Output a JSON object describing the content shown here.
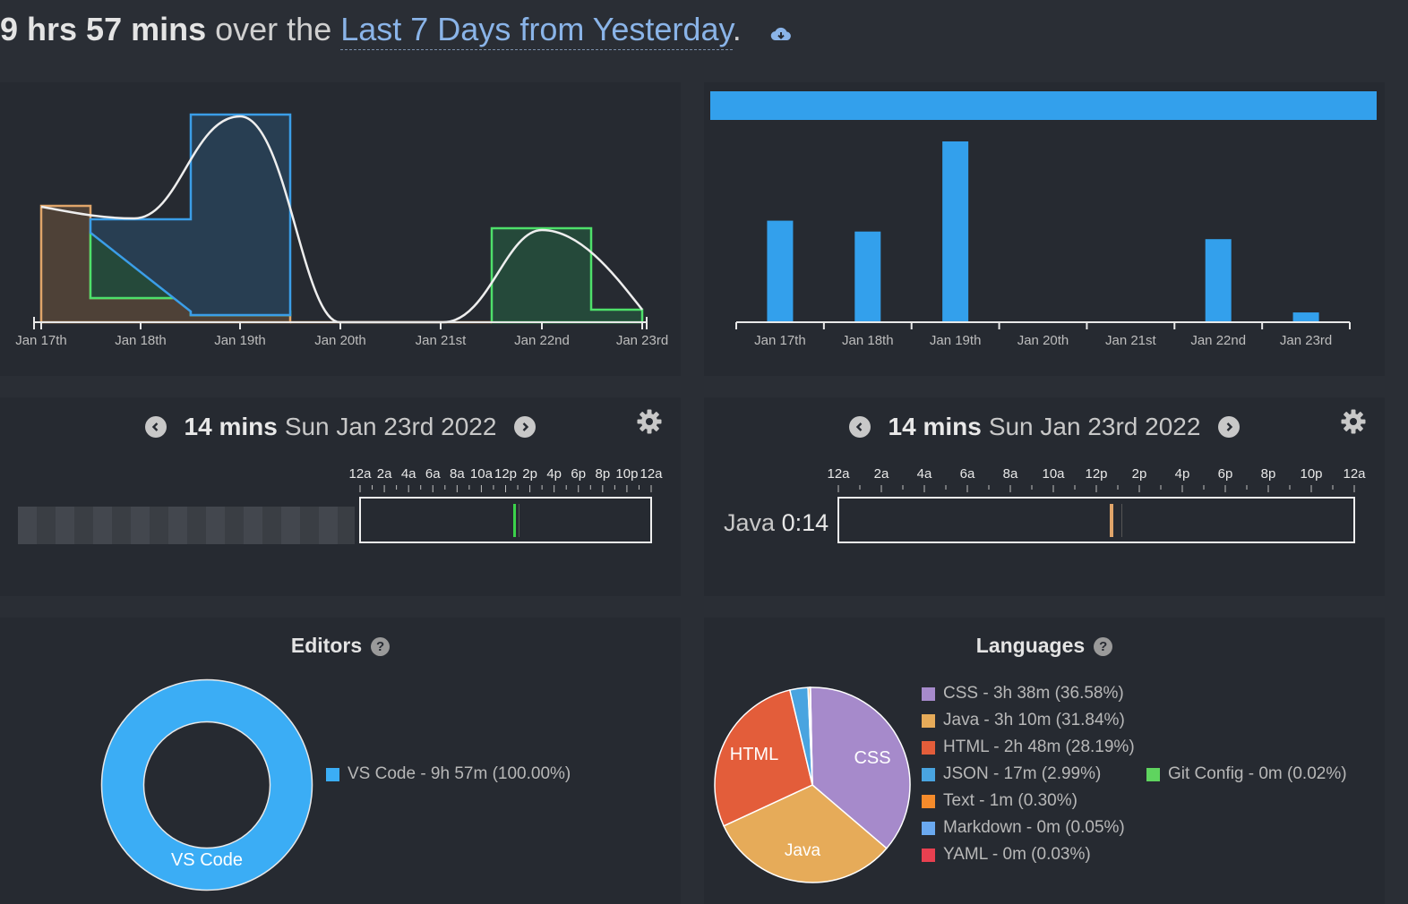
{
  "header": {
    "total": "9 hrs 57 mins",
    "middle": "over the",
    "range": "Last 7 Days from Yesterday",
    "period": ".",
    "cloud_icon": "cloud-download-icon"
  },
  "activity_chart": {
    "x_ticks": [
      "Jan 17th",
      "Jan 18th",
      "Jan 19th",
      "Jan 20th",
      "Jan 21st",
      "Jan 22nd",
      "Jan 23rd"
    ],
    "colors": {
      "orange": "#e0a56a",
      "green": "#4ee06a",
      "blue": "#3b9ee8",
      "curve": "#f0f0f0"
    }
  },
  "chart_data": {
    "type": "bar",
    "categories": [
      "Jan 17th",
      "Jan 18th",
      "Jan 19th",
      "Jan 20th",
      "Jan 21st",
      "Jan 22nd",
      "Jan 23rd"
    ],
    "values": [
      1.87,
      1.67,
      3.33,
      0,
      0,
      1.53,
      0.18
    ],
    "color": "#33a0ec",
    "grid": false
  },
  "timeline_1": {
    "duration": "14 mins",
    "date": "Sun Jan 23rd 2022",
    "hour_labels": [
      "12a",
      "2a",
      "4a",
      "6a",
      "8a",
      "10a",
      "12p",
      "2p",
      "4p",
      "6p",
      "8p",
      "10p",
      "12a"
    ],
    "activity_color": "#3bd24a"
  },
  "timeline_2": {
    "duration": "14 mins",
    "date": "Sun Jan 23rd 2022",
    "hour_labels": [
      "12a",
      "2a",
      "4a",
      "6a",
      "8a",
      "10a",
      "12p",
      "2p",
      "4p",
      "6p",
      "8p",
      "10p",
      "12a"
    ],
    "language": "Java",
    "language_time": "0:14",
    "activity_color": "#e0a56a"
  },
  "editors": {
    "title": "Editors",
    "help": "?",
    "donut_label": "VS Code",
    "legend": [
      {
        "label": "VS Code - 9h 57m (100.00%)",
        "color": "#3badf5"
      }
    ]
  },
  "languages": {
    "title": "Languages",
    "help": "?",
    "slice_labels": {
      "css": "CSS",
      "java": "Java",
      "html": "HTML"
    },
    "legend": [
      {
        "label": "CSS - 3h 38m (36.58%)",
        "color": "#a68acb",
        "percent": 36.58
      },
      {
        "label": "Java - 3h 10m (31.84%)",
        "color": "#e6ab59",
        "percent": 31.84
      },
      {
        "label": "HTML - 2h 48m (28.19%)",
        "color": "#e35d3a",
        "percent": 28.19
      },
      {
        "label": "JSON - 17m (2.99%)",
        "color": "#49a4e0",
        "percent": 2.99
      },
      {
        "label": "Text - 1m (0.30%)",
        "color": "#f58b2b",
        "percent": 0.3
      },
      {
        "label": "Markdown - 0m (0.05%)",
        "color": "#6aa9f0",
        "percent": 0.05
      },
      {
        "label": "YAML - 0m (0.03%)",
        "color": "#e84050",
        "percent": 0.03
      },
      {
        "label": "Git Config - 0m (0.02%)",
        "color": "#5fd45f",
        "percent": 0.02
      }
    ]
  }
}
